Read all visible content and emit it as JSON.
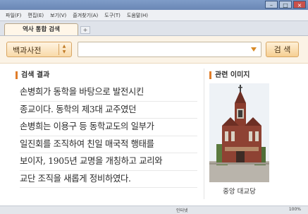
{
  "menu": {
    "items": [
      "파일(F)",
      "편집(E)",
      "보기(V)",
      "즐겨찾기(A)",
      "도구(T)",
      "도움말(H)"
    ]
  },
  "tabs": {
    "active_label": "역사 통합 검색",
    "new_tab_label": "+"
  },
  "search": {
    "category": "백과사전",
    "query": "",
    "button_label": "검 색"
  },
  "results": {
    "title": "검색 결과",
    "lines": [
      "손병희가 동학을 바탕으로 발전시킨",
      "종교이다. 동학의 제3대 교주였던",
      "손병희는 이용구 등 동학교도의 일부가",
      "일진회를 조직하여 친일 매국적 행태를",
      "보이자, 1905년 교명을 개칭하고 교리와",
      "교단 조직을 새롭게 정비하였다."
    ]
  },
  "images": {
    "title": "관련 이미지",
    "caption": "중앙 대교당"
  },
  "status": {
    "zone": "인터넷",
    "zoom": "100%"
  },
  "colors": {
    "accent": "#e07d2a",
    "search_bar_bg": "#fbf3e6"
  }
}
